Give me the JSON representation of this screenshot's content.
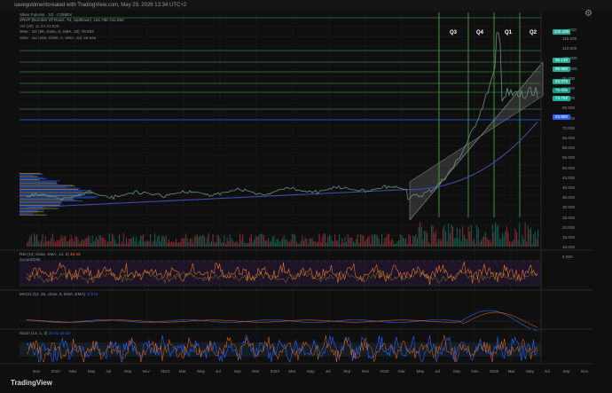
{
  "header": {
    "caption": "savegoldmentcreated with TradingView.com, May 29, 2026 13:34 UTC+2"
  },
  "legend": {
    "title": "Silver Futures · 1D · COMEX",
    "rows": [
      {
        "label": "VRVP (Number Of Rows, 70, Up/Down)",
        "value": "154.73K 511.56K"
      },
      {
        "label": "Vol (20)",
        "value": "11.44 44.92K"
      },
      {
        "label": "SMA · 1D (50, close, 0, SMA, 20)",
        "value": "78.593"
      },
      {
        "label": "SMA · 1D (200, close, 0, SMA, 20)",
        "value": "59.646"
      }
    ]
  },
  "quarters": [
    "Q3",
    "Q4",
    "Q1",
    "Q2"
  ],
  "price_axis": {
    "currency": "USD",
    "ticks": [
      "115.000",
      "110.000",
      "105.000",
      "100.000",
      "95.000",
      "90.000",
      "85.000",
      "80.000",
      "75.000",
      "70.000",
      "65.000",
      "60.000",
      "55.000",
      "50.000",
      "45.000",
      "40.000",
      "35.000",
      "30.000",
      "25.000",
      "20.000",
      "15.000",
      "10.000",
      "5.000"
    ],
    "labels": [
      {
        "text": "102.430",
        "color": "#22ab94"
      },
      {
        "text": "96.130",
        "color": "#22ab94"
      },
      {
        "text": "88.980",
        "color": "#22ab94"
      },
      {
        "text": "83.075",
        "color": "#22ab94"
      },
      {
        "text": "75.935",
        "color": "#089981"
      },
      {
        "text": "73.750",
        "color": "#22ab94"
      },
      {
        "text": "63.580",
        "color": "#2962ff"
      }
    ]
  },
  "panels": {
    "rsi": {
      "label": "RSI (14, close, SMA, 14, 2)",
      "value": "46.43",
      "sub": "Accum/Dist"
    },
    "macd": {
      "label": "MACD (12, 26, close, 9, EMA, EMA)",
      "value": "-0.573"
    },
    "stoch": {
      "label": "Stoch (14, 1, 3)",
      "value": "31.51 32.53"
    }
  },
  "time_axis": [
    "Nov",
    "2022",
    "Mar",
    "May",
    "Jul",
    "Sep",
    "Nov",
    "2023",
    "Mar",
    "May",
    "Jul",
    "Sep",
    "Nov",
    "2024",
    "Mar",
    "May",
    "Jul",
    "Sep",
    "Nov",
    "2025",
    "Mar",
    "May",
    "Jul",
    "Sep",
    "Nov",
    "2026",
    "Mar",
    "May",
    "Jul",
    "Sep",
    "Nov"
  ],
  "brand": "TradingView",
  "colors": {
    "green_line": "#4caf50",
    "blue_line": "#2962ff",
    "sma200": "#3f51b5",
    "bull": "#089981",
    "bear": "#f23645"
  }
}
